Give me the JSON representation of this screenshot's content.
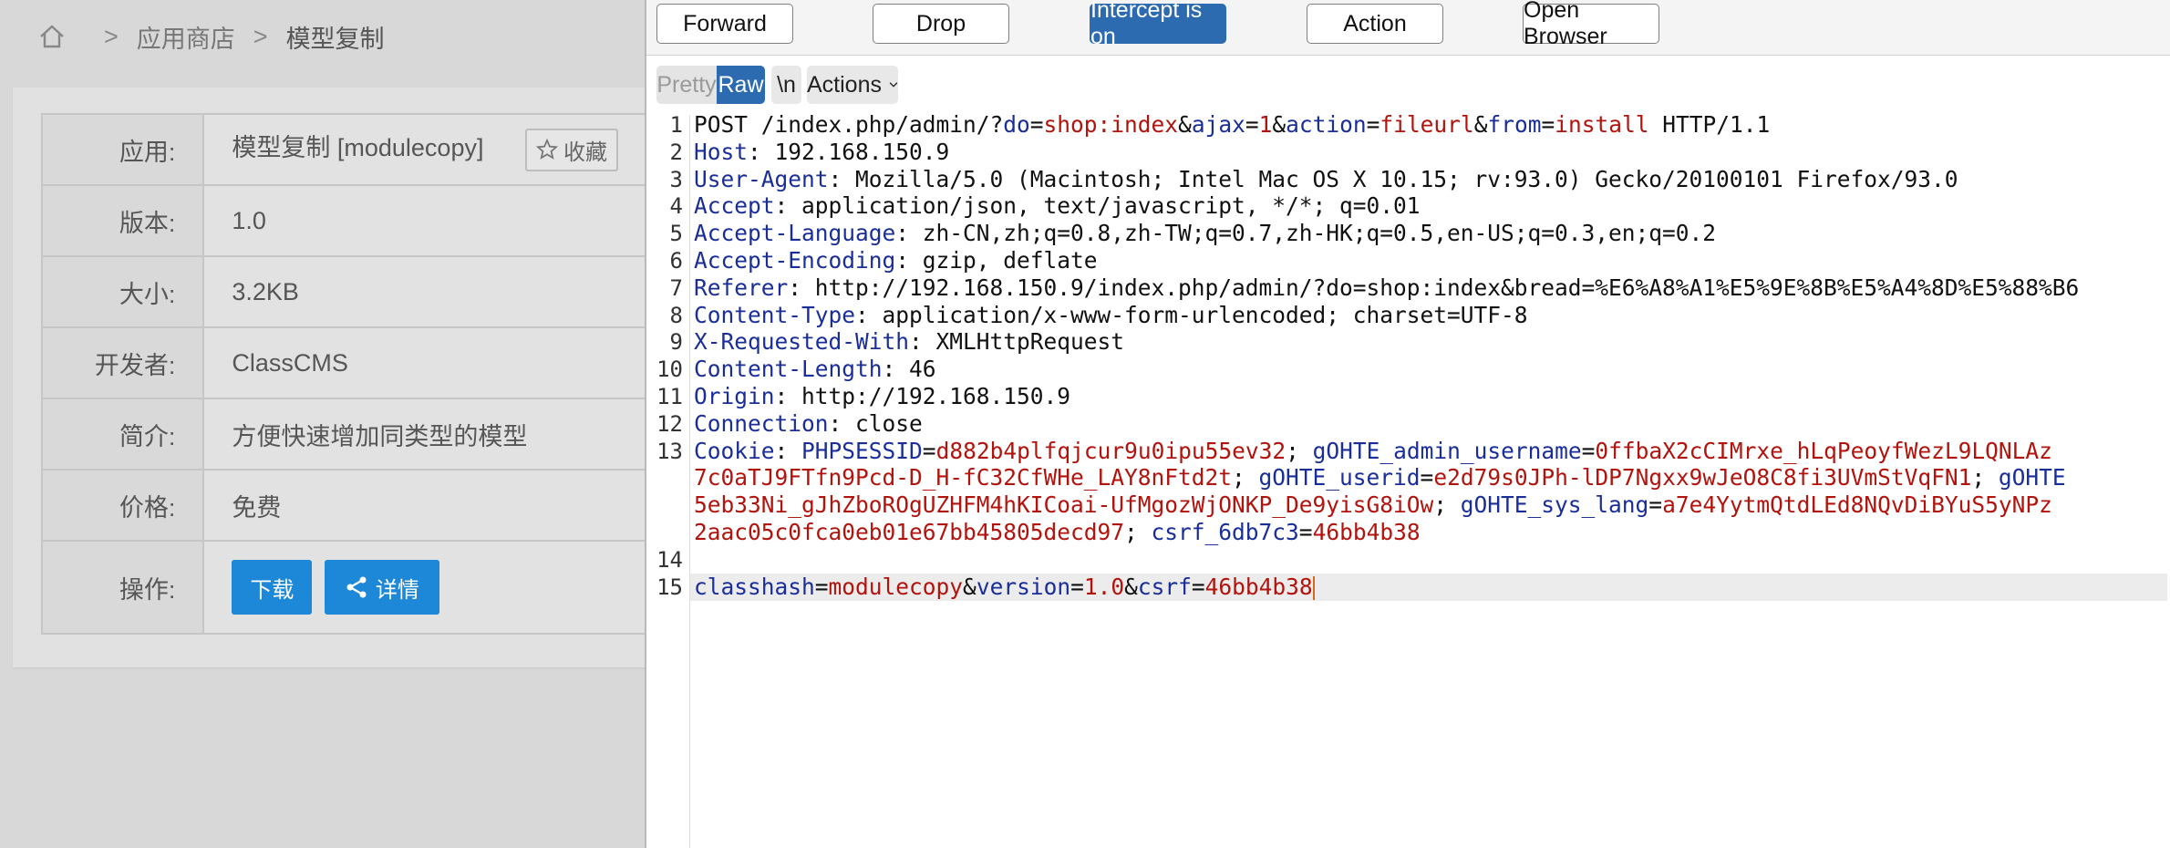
{
  "cms": {
    "breadcrumb": [
      "应用商店",
      "模型复制"
    ],
    "fields": [
      {
        "label": "应用:",
        "value": "模型复制 [modulecopy]"
      },
      {
        "label": "版本:",
        "value": "1.0"
      },
      {
        "label": "大小:",
        "value": "3.2KB"
      },
      {
        "label": "开发者:",
        "value": "ClassCMS"
      },
      {
        "label": "简介:",
        "value": "方便快速增加同类型的模型"
      },
      {
        "label": "价格:",
        "value": "免费"
      },
      {
        "label": "操作:",
        "value": ""
      }
    ],
    "favorite_label": "收藏",
    "download_label": "下载",
    "detail_label": "详情"
  },
  "burp": {
    "toolbar": {
      "forward": "Forward",
      "drop": "Drop",
      "intercept": "Intercept is on",
      "action": "Action",
      "open_browser": "Open Browser"
    },
    "view": {
      "pretty": "Pretty",
      "raw": "Raw",
      "newline": "\\n",
      "actions": "Actions"
    },
    "lines": [
      [
        [
          "p",
          "POST /index.php/admin/?"
        ],
        [
          "k",
          "do"
        ],
        [
          "p",
          "="
        ],
        [
          "v",
          "shop:index"
        ],
        [
          "p",
          "&"
        ],
        [
          "k",
          "ajax"
        ],
        [
          "p",
          "="
        ],
        [
          "v",
          "1"
        ],
        [
          "p",
          "&"
        ],
        [
          "k",
          "action"
        ],
        [
          "p",
          "="
        ],
        [
          "v",
          "fileurl"
        ],
        [
          "p",
          "&"
        ],
        [
          "k",
          "from"
        ],
        [
          "p",
          "="
        ],
        [
          "v",
          "install"
        ],
        [
          "p",
          " HTTP/1.1"
        ]
      ],
      [
        [
          "k",
          "Host"
        ],
        [
          "p",
          ": 192.168.150.9"
        ]
      ],
      [
        [
          "k",
          "User-Agent"
        ],
        [
          "p",
          ": Mozilla/5.0 (Macintosh; Intel Mac OS X 10.15; rv:93.0) Gecko/20100101 Firefox/93.0"
        ]
      ],
      [
        [
          "k",
          "Accept"
        ],
        [
          "p",
          ": application/json, text/javascript, */*; q=0.01"
        ]
      ],
      [
        [
          "k",
          "Accept-Language"
        ],
        [
          "p",
          ": zh-CN,zh;q=0.8,zh-TW;q=0.7,zh-HK;q=0.5,en-US;q=0.3,en;q=0.2"
        ]
      ],
      [
        [
          "k",
          "Accept-Encoding"
        ],
        [
          "p",
          ": gzip, deflate"
        ]
      ],
      [
        [
          "k",
          "Referer"
        ],
        [
          "p",
          ": http://192.168.150.9/index.php/admin/?do=shop:index&bread=%E6%A8%A1%E5%9E%8B%E5%A4%8D%E5%88%B6"
        ]
      ],
      [
        [
          "k",
          "Content-Type"
        ],
        [
          "p",
          ": application/x-www-form-urlencoded; charset=UTF-8"
        ]
      ],
      [
        [
          "k",
          "X-Requested-With"
        ],
        [
          "p",
          ": XMLHttpRequest"
        ]
      ],
      [
        [
          "k",
          "Content-Length"
        ],
        [
          "p",
          ": 46"
        ]
      ],
      [
        [
          "k",
          "Origin"
        ],
        [
          "p",
          ": http://192.168.150.9"
        ]
      ],
      [
        [
          "k",
          "Connection"
        ],
        [
          "p",
          ": close"
        ]
      ],
      [
        [
          "k",
          "Cookie"
        ],
        [
          "p",
          ": "
        ],
        [
          "k",
          "PHPSESSID"
        ],
        [
          "p",
          "="
        ],
        [
          "v",
          "d882b4plfqjcur9u0ipu55ev32"
        ],
        [
          "p",
          "; "
        ],
        [
          "k",
          "gOHTE_admin_username"
        ],
        [
          "p",
          "="
        ],
        [
          "v",
          "0ffbaX2cCIMrxe_hLqPeoyfWezL9LQNLAz"
        ]
      ],
      [
        [
          "v",
          "7c0aTJ9FTfn9Pcd-D_H-fC32CfWHe_LAY8nFtd2t"
        ],
        [
          "p",
          "; "
        ],
        [
          "k",
          "gOHTE_userid"
        ],
        [
          "p",
          "="
        ],
        [
          "v",
          "e2d79s0JPh-lDP7Ngxx9wJeO8C8fi3UVmStVqFN1"
        ],
        [
          "p",
          "; "
        ],
        [
          "k",
          "gOHTE"
        ]
      ],
      [
        [
          "v",
          "5eb33Ni_gJhZboROgUZHFM4hKICoai-UfMgozWjONKP_De9yisG8iOw"
        ],
        [
          "p",
          "; "
        ],
        [
          "k",
          "gOHTE_sys_lang"
        ],
        [
          "p",
          "="
        ],
        [
          "v",
          "a7e4YytmQtdLEd8NQvDiBYuS5yNPz"
        ]
      ],
      [
        [
          "v",
          "2aac05c0fca0eb01e67bb45805decd97"
        ],
        [
          "p",
          "; "
        ],
        [
          "k",
          "csrf_6db7c3"
        ],
        [
          "p",
          "="
        ],
        [
          "v",
          "46bb4b38"
        ]
      ],
      [],
      [
        [
          "k",
          "classhash"
        ],
        [
          "p",
          "="
        ],
        [
          "v",
          "modulecopy"
        ],
        [
          "p",
          "&"
        ],
        [
          "k",
          "version"
        ],
        [
          "p",
          "="
        ],
        [
          "v",
          "1.0"
        ],
        [
          "p",
          "&"
        ],
        [
          "k",
          "csrf"
        ],
        [
          "p",
          "="
        ],
        [
          "v",
          "46bb4b38"
        ]
      ]
    ],
    "line_numbers": [
      "1",
      "2",
      "3",
      "4",
      "5",
      "6",
      "7",
      "8",
      "9",
      "10",
      "11",
      "12",
      "13",
      "",
      "",
      "",
      "14",
      "15"
    ]
  }
}
